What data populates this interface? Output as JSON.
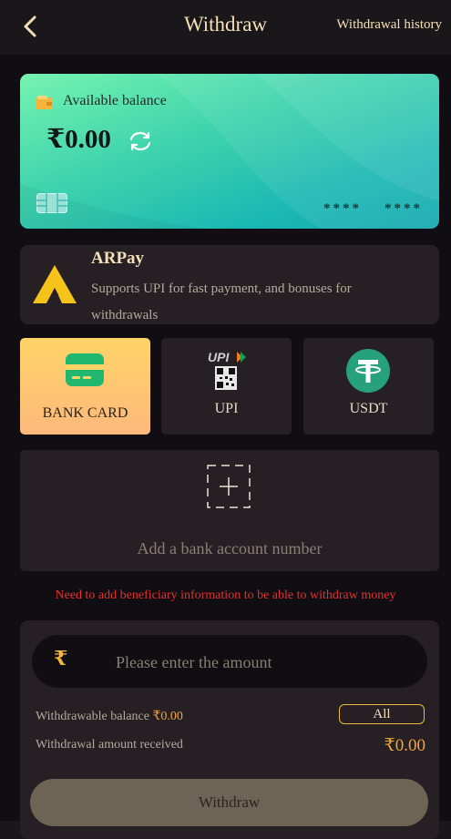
{
  "header": {
    "title": "Withdraw",
    "history_label": "Withdrawal history"
  },
  "balance_card": {
    "label": "Available balance",
    "amount": "₹0.00",
    "mask_1": "****",
    "mask_2": "****",
    "gradient_start": "#76f3b0",
    "gradient_end": "#14aab1"
  },
  "channel": {
    "name": "ARPay",
    "description": "Supports UPI for fast payment, and bonuses for withdrawals"
  },
  "methods": [
    {
      "label": "BANK CARD",
      "icon": "bank-card-icon",
      "active": true
    },
    {
      "label": "UPI",
      "icon": "upi-qr-icon",
      "active": false
    },
    {
      "label": "USDT",
      "icon": "tether-icon",
      "active": false
    }
  ],
  "add_account": {
    "label": "Add a bank account number"
  },
  "warning": "Need to add beneficiary information to be able to withdraw money",
  "withdraw_form": {
    "currency_symbol": "₹",
    "amount_placeholder": "Please enter the amount",
    "withdrawable_label": "Withdrawable balance",
    "withdrawable_value": "₹0.00",
    "all_label": "All",
    "received_label": "Withdrawal amount received",
    "received_value": "₹0.00",
    "submit_label": "Withdraw"
  },
  "colors": {
    "accent": "#f2a43a",
    "warning": "#e5312f",
    "title": "#f5dfb8"
  }
}
